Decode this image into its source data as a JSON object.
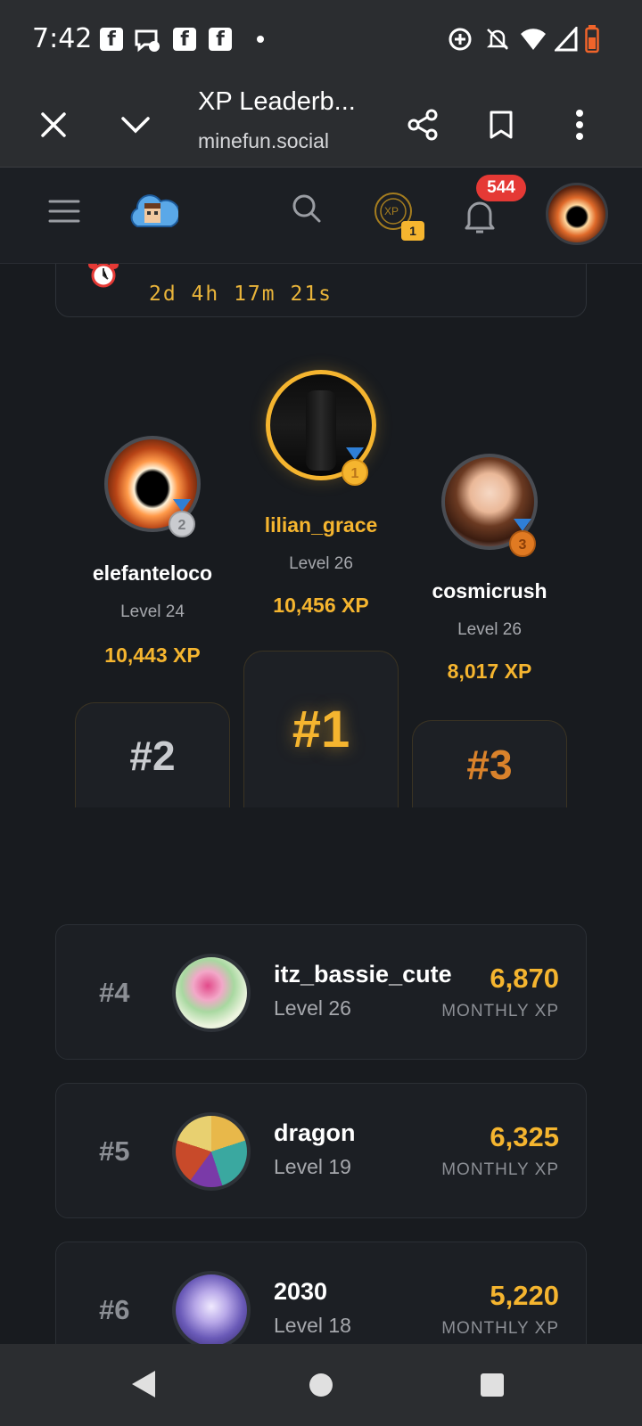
{
  "status_bar": {
    "time": "7:42",
    "notifications": [
      "facebook-icon",
      "messenger-icon",
      "facebook-icon",
      "facebook-icon"
    ],
    "right_icons": [
      "data-saver-icon",
      "mute-icon",
      "wifi-icon",
      "signal-icon",
      "battery-icon"
    ]
  },
  "browser": {
    "title": "XP Leaderb...",
    "url": "minefun.social",
    "actions": [
      "close-icon",
      "chevron-down-icon",
      "share-icon",
      "bookmark-icon",
      "more-vert-icon"
    ]
  },
  "app_header": {
    "xp_badge_label": "XP",
    "xp_count": "1",
    "notification_count": "544"
  },
  "timer": {
    "value": "2d 4h 17m 21s"
  },
  "podium": [
    {
      "rank_label": "#1",
      "name": "lilian_grace",
      "level": "Level 26",
      "xp": "10,456 XP",
      "medal": "1",
      "color": "#f5b52f"
    },
    {
      "rank_label": "#2",
      "name": "elefanteloco",
      "level": "Level 24",
      "xp": "10,443 XP",
      "medal": "2",
      "color": "#c9cbcf"
    },
    {
      "rank_label": "#3",
      "name": "cosmicrush",
      "level": "Level 26",
      "xp": "8,017 XP",
      "medal": "3",
      "color": "#d9822b"
    }
  ],
  "leaderboard": [
    {
      "rank": "#4",
      "name": "itz_bassie_cute",
      "level": "Level 26",
      "xp": "6,870",
      "xp_label": "MONTHLY XP"
    },
    {
      "rank": "#5",
      "name": "dragon",
      "level": "Level 19",
      "xp": "6,325",
      "xp_label": "MONTHLY XP"
    },
    {
      "rank": "#6",
      "name": "2030",
      "level": "Level 18",
      "xp": "5,220",
      "xp_label": "MONTHLY XP"
    }
  ],
  "nav_bar": {
    "buttons": [
      "back-icon",
      "home-icon",
      "recents-icon"
    ]
  }
}
